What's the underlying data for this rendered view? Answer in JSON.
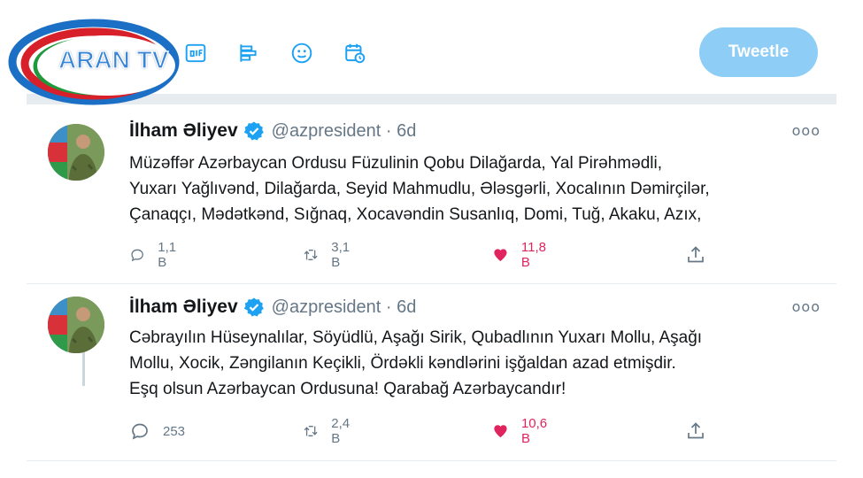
{
  "logo": {
    "text": "ARAN TV"
  },
  "compose": {
    "tweet_button": "Tweetle",
    "tools": [
      "image-icon",
      "gif-icon",
      "poll-icon",
      "emoji-icon",
      "schedule-icon"
    ]
  },
  "colors": {
    "accent": "#1da1f2",
    "button_disabled": "#8ecdf5",
    "like": "#e0245e",
    "muted": "#657786"
  },
  "tweets": [
    {
      "name": "İlham Əliyev",
      "handle": "@azpresident · 6d",
      "more": "ooo",
      "lines": [
        "Müzəffər Azərbaycan Ordusu Füzulinin Qobu Dilağarda, Yal Pirəhmədli,",
        "Yuxarı Yağlıvənd, Dilağarda, Seyid Mahmudlu, Ələsgərli, Xocalının Dəmirçilər,",
        "Çanaqçı, Mədətkənd, Sığnaq, Xocavəndin Susanlıq, Domi, Tuğ, Akaku, Azıx,"
      ],
      "replies": "1,1 B",
      "retweets": "3,1 B",
      "likes": "11,8 B"
    },
    {
      "name": "İlham Əliyev",
      "handle": "@azpresident · 6d",
      "more": "ooo",
      "lines": [
        "Cəbrayılın Hüseynalılar, Söyüdlü, Aşağı Sirik, Qubadlının Yuxarı Mollu, Aşağı",
        "Mollu, Xocik, Zəngilanın Keçikli, Ördəkli kəndlərini işğaldan azad etmişdir.",
        "Eşq olsun Azərbaycan Ordusuna! Qarabağ Azərbaycandır!"
      ],
      "replies": "253",
      "retweets": "2,4 B",
      "likes": "10,6 B"
    }
  ]
}
